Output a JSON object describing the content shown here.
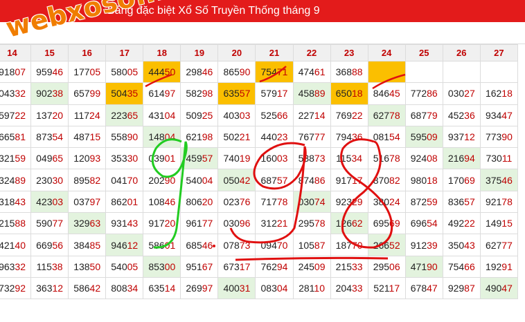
{
  "title": "Bảng đặc biệt Xổ Số Truyền Thống tháng 9",
  "watermark": "webxoso.net",
  "colors": {
    "header_red": "#e31b1b",
    "tail_red": "#c00000",
    "green_cell": "#e3f3de",
    "gold_cell": "#fbbf00",
    "stroke_red": "#e01010",
    "stroke_green": "#22cc22"
  },
  "columns": [
    "14",
    "15",
    "16",
    "17",
    "18",
    "19",
    "20",
    "21",
    "22",
    "23",
    "24",
    "25",
    "26",
    "27"
  ],
  "rows": [
    [
      {
        "h": "918",
        "t": "07"
      },
      {
        "h": "959",
        "t": "46"
      },
      {
        "h": "177",
        "t": "05"
      },
      {
        "h": "580",
        "t": "05"
      },
      {
        "h": "444",
        "t": "50",
        "c": "gold"
      },
      {
        "h": "298",
        "t": "46"
      },
      {
        "h": "865",
        "t": "90"
      },
      {
        "h": "754",
        "t": "71",
        "c": "gold"
      },
      {
        "h": "474",
        "t": "61"
      },
      {
        "h": "368",
        "t": "88"
      },
      {
        "h": "",
        "t": "",
        "c": "gold"
      },
      {
        "h": "",
        "t": ""
      },
      {
        "h": "",
        "t": ""
      },
      {
        "h": "",
        "t": ""
      }
    ],
    [
      {
        "h": "043",
        "t": "32"
      },
      {
        "h": "902",
        "t": "38",
        "c": "green"
      },
      {
        "h": "657",
        "t": "99"
      },
      {
        "h": "504",
        "t": "35",
        "c": "gold"
      },
      {
        "h": "614",
        "t": "97"
      },
      {
        "h": "582",
        "t": "98"
      },
      {
        "h": "635",
        "t": "57",
        "c": "gold"
      },
      {
        "h": "579",
        "t": "17"
      },
      {
        "h": "458",
        "t": "89",
        "c": "green"
      },
      {
        "h": "650",
        "t": "18",
        "c": "gold"
      },
      {
        "h": "846",
        "t": "45"
      },
      {
        "h": "772",
        "t": "86"
      },
      {
        "h": "030",
        "t": "27"
      },
      {
        "h": "162",
        "t": "18"
      }
    ],
    [
      {
        "h": "597",
        "t": "22"
      },
      {
        "h": "137",
        "t": "20"
      },
      {
        "h": "117",
        "t": "24"
      },
      {
        "h": "223",
        "t": "65",
        "c": "green"
      },
      {
        "h": "431",
        "t": "04"
      },
      {
        "h": "509",
        "t": "25"
      },
      {
        "h": "403",
        "t": "03"
      },
      {
        "h": "525",
        "t": "66"
      },
      {
        "h": "227",
        "t": "14"
      },
      {
        "h": "769",
        "t": "22"
      },
      {
        "h": "627",
        "t": "78",
        "c": "green"
      },
      {
        "h": "687",
        "t": "79"
      },
      {
        "h": "452",
        "t": "36"
      },
      {
        "h": "934",
        "t": "47"
      }
    ],
    [
      {
        "h": "665",
        "t": "81"
      },
      {
        "h": "873",
        "t": "54"
      },
      {
        "h": "487",
        "t": "15"
      },
      {
        "h": "558",
        "t": "90"
      },
      {
        "h": "148",
        "t": "04",
        "c": "green"
      },
      {
        "h": "621",
        "t": "98"
      },
      {
        "h": "502",
        "t": "21"
      },
      {
        "h": "440",
        "t": "23"
      },
      {
        "h": "767",
        "t": "77"
      },
      {
        "h": "794",
        "t": "36"
      },
      {
        "h": "081",
        "t": "54"
      },
      {
        "h": "595",
        "t": "09",
        "c": "green"
      },
      {
        "h": "937",
        "t": "12"
      },
      {
        "h": "773",
        "t": "90"
      }
    ],
    [
      {
        "h": "321",
        "t": "59"
      },
      {
        "h": "049",
        "t": "65"
      },
      {
        "h": "120",
        "t": "93"
      },
      {
        "h": "353",
        "t": "30"
      },
      {
        "h": "039",
        "t": "01"
      },
      {
        "h": "459",
        "t": "57",
        "c": "green"
      },
      {
        "h": "740",
        "t": "19"
      },
      {
        "h": "160",
        "t": "03"
      },
      {
        "h": "538",
        "t": "73"
      },
      {
        "h": "115",
        "t": "34"
      },
      {
        "h": "516",
        "t": "78"
      },
      {
        "h": "924",
        "t": "08"
      },
      {
        "h": "216",
        "t": "94",
        "c": "green"
      },
      {
        "h": "730",
        "t": "11"
      }
    ],
    [
      {
        "h": "324",
        "t": "89"
      },
      {
        "h": "230",
        "t": "30"
      },
      {
        "h": "895",
        "t": "82"
      },
      {
        "h": "041",
        "t": "70"
      },
      {
        "h": "202",
        "t": "90"
      },
      {
        "h": "540",
        "t": "04"
      },
      {
        "h": "050",
        "t": "42",
        "c": "green"
      },
      {
        "h": "687",
        "t": "57"
      },
      {
        "h": "874",
        "t": "86"
      },
      {
        "h": "917",
        "t": "17"
      },
      {
        "h": "870",
        "t": "82"
      },
      {
        "h": "980",
        "t": "18"
      },
      {
        "h": "170",
        "t": "69"
      },
      {
        "h": "375",
        "t": "46",
        "c": "green"
      }
    ],
    [
      {
        "h": "318",
        "t": "43"
      },
      {
        "h": "423",
        "t": "03",
        "c": "green"
      },
      {
        "h": "037",
        "t": "97"
      },
      {
        "h": "862",
        "t": "01"
      },
      {
        "h": "108",
        "t": "46"
      },
      {
        "h": "806",
        "t": "20"
      },
      {
        "h": "023",
        "t": "76"
      },
      {
        "h": "717",
        "t": "78"
      },
      {
        "h": "030",
        "t": "74",
        "c": "green"
      },
      {
        "h": "923",
        "t": "29"
      },
      {
        "h": "380",
        "t": "24"
      },
      {
        "h": "872",
        "t": "59"
      },
      {
        "h": "836",
        "t": "57"
      },
      {
        "h": "921",
        "t": "78"
      }
    ],
    [
      {
        "h": "215",
        "t": "88"
      },
      {
        "h": "590",
        "t": "77"
      },
      {
        "h": "329",
        "t": "63",
        "c": "green"
      },
      {
        "h": "931",
        "t": "43"
      },
      {
        "h": "917",
        "t": "20"
      },
      {
        "h": "961",
        "t": "77"
      },
      {
        "h": "030",
        "t": "96"
      },
      {
        "h": "312",
        "t": "21"
      },
      {
        "h": "295",
        "t": "78"
      },
      {
        "h": "126",
        "t": "62",
        "c": "green"
      },
      {
        "h": "695",
        "t": "69"
      },
      {
        "h": "696",
        "t": "54"
      },
      {
        "h": "492",
        "t": "22"
      },
      {
        "h": "149",
        "t": "15"
      }
    ],
    [
      {
        "h": "421",
        "t": "40"
      },
      {
        "h": "669",
        "t": "56"
      },
      {
        "h": "384",
        "t": "85"
      },
      {
        "h": "946",
        "t": "12",
        "c": "green"
      },
      {
        "h": "586",
        "t": "01"
      },
      {
        "h": "685",
        "t": "46"
      },
      {
        "h": "078",
        "t": "73"
      },
      {
        "h": "094",
        "t": "70"
      },
      {
        "h": "105",
        "t": "87"
      },
      {
        "h": "187",
        "t": "70"
      },
      {
        "h": "266",
        "t": "52",
        "c": "green"
      },
      {
        "h": "912",
        "t": "39"
      },
      {
        "h": "350",
        "t": "43"
      },
      {
        "h": "627",
        "t": "77"
      }
    ],
    [
      {
        "h": "963",
        "t": "32"
      },
      {
        "h": "115",
        "t": "38"
      },
      {
        "h": "138",
        "t": "50"
      },
      {
        "h": "540",
        "t": "05"
      },
      {
        "h": "853",
        "t": "00",
        "c": "green"
      },
      {
        "h": "951",
        "t": "67"
      },
      {
        "h": "673",
        "t": "17"
      },
      {
        "h": "762",
        "t": "94"
      },
      {
        "h": "245",
        "t": "09"
      },
      {
        "h": "215",
        "t": "33"
      },
      {
        "h": "295",
        "t": "06"
      },
      {
        "h": "471",
        "t": "90",
        "c": "green"
      },
      {
        "h": "754",
        "t": "66"
      },
      {
        "h": "192",
        "t": "91"
      }
    ],
    [
      {
        "h": "732",
        "t": "92"
      },
      {
        "h": "363",
        "t": "12"
      },
      {
        "h": "586",
        "t": "42"
      },
      {
        "h": "808",
        "t": "34"
      },
      {
        "h": "635",
        "t": "14"
      },
      {
        "h": "269",
        "t": "97"
      },
      {
        "h": "400",
        "t": "31",
        "c": "green"
      },
      {
        "h": "083",
        "t": "04"
      },
      {
        "h": "281",
        "t": "10"
      },
      {
        "h": "204",
        "t": "33"
      },
      {
        "h": "521",
        "t": "17"
      },
      {
        "h": "678",
        "t": "47"
      },
      {
        "h": "929",
        "t": "87"
      },
      {
        "h": "490",
        "t": "47",
        "c": "green"
      }
    ]
  ]
}
